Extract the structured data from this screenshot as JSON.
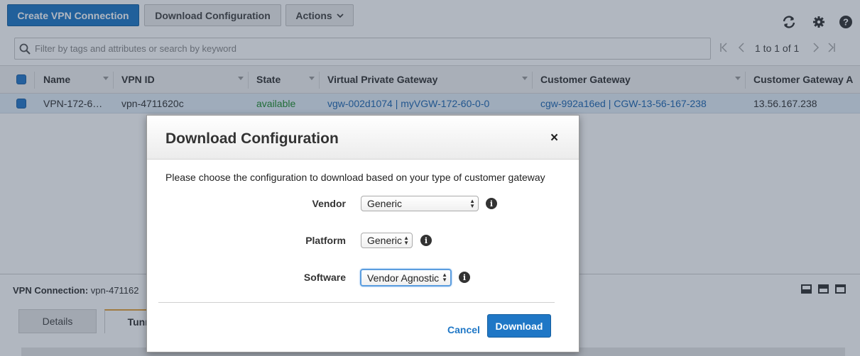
{
  "toolbar": {
    "create_label": "Create VPN Connection",
    "download_label": "Download Configuration",
    "actions_label": "Actions",
    "icons": [
      "refresh-icon",
      "gear-icon",
      "help-icon"
    ]
  },
  "search": {
    "placeholder": "Filter by tags and attributes or search by keyword"
  },
  "pagination": {
    "text": "1 to 1 of 1"
  },
  "table": {
    "columns": [
      "Name",
      "VPN ID",
      "State",
      "Virtual Private Gateway",
      "Customer Gateway",
      "Customer Gateway A"
    ],
    "rows": [
      {
        "name": "VPN-172-6…",
        "vpn_id": "vpn-4711620c",
        "state": "available",
        "vgw": "vgw-002d1074 | myVGW-172-60-0-0",
        "cgw": "cgw-992a16ed | CGW-13-56-167-238",
        "cgw_address": "13.56.167.238"
      }
    ]
  },
  "details_panel": {
    "title_label": "VPN Connection:",
    "title_value": "vpn-471162",
    "tabs": [
      "Details",
      "Tunnel"
    ]
  },
  "modal": {
    "title": "Download Configuration",
    "close": "×",
    "description": "Please choose the configuration to download based on your type of customer gateway",
    "vendor_label": "Vendor",
    "vendor_value": "Generic",
    "platform_label": "Platform",
    "platform_value": "Generic",
    "software_label": "Software",
    "software_value": "Vendor Agnostic",
    "cancel_label": "Cancel",
    "download_label": "Download"
  },
  "colors": {
    "primary": "#1f77c6",
    "link": "#1f67b1",
    "available": "#1e8b2b",
    "selected_row": "#e3eef8"
  }
}
